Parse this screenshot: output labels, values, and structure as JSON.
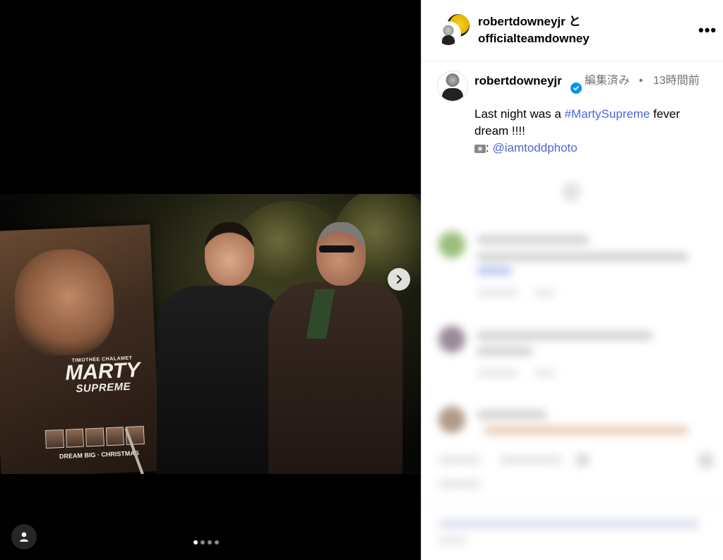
{
  "media": {
    "poster": {
      "top_credit": "TIMOTHÉE CHALAMET",
      "title_line1": "MARTY",
      "title_line2": "SUPREME",
      "tagline": "DREAM BIG · CHRISTMAS"
    },
    "carousel": {
      "count": 4,
      "active_index": 0
    },
    "icons": {
      "next": "chevron-right-icon",
      "tag": "person-tag-icon"
    }
  },
  "header": {
    "line1": "robertdowneyjr と",
    "line2": "officialteamdowney",
    "more": "•••"
  },
  "caption": {
    "username": "robertdowneyjr",
    "edited": "編集済み",
    "separator": "•",
    "time": "13時間前",
    "text_before": "Last night was a ",
    "hashtag": "#MartySupreme",
    "text_after": " fever dream !!!!",
    "photo_credit_sep": ": ",
    "mention": "@iamtoddphoto"
  },
  "colors": {
    "link": "#4c68d7",
    "verified": "#0095f6",
    "muted": "#737373"
  }
}
